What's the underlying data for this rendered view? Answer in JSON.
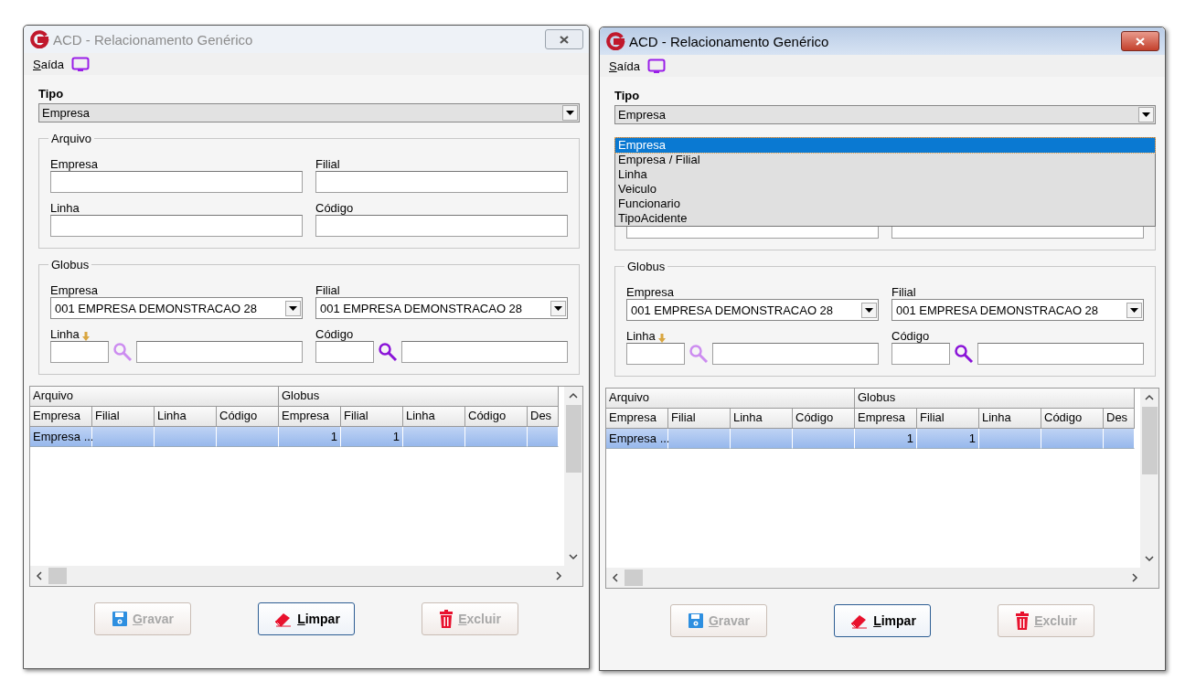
{
  "windows": [
    {
      "active": false,
      "title": "ACD - Relacionamento Genérico",
      "menu": [
        {
          "label": "Saída"
        }
      ],
      "tipo": {
        "label": "Tipo",
        "value": "Empresa"
      },
      "arquivo": {
        "legend": "Arquivo",
        "fields": [
          {
            "label": "Empresa"
          },
          {
            "label": "Filial"
          },
          {
            "label": "Linha"
          },
          {
            "label": "Código"
          }
        ]
      },
      "globus": {
        "legend": "Globus",
        "fields": [
          {
            "label": "Empresa",
            "kind": "combo",
            "value": "001 EMPRESA DEMONSTRACAO 28"
          },
          {
            "label": "Filial",
            "kind": "combo",
            "value": "001 EMPRESA DEMONSTRACAO 28"
          },
          {
            "label": "Linha",
            "kind": "lookup",
            "marked": true,
            "search_active": false
          },
          {
            "label": "Código",
            "kind": "lookup",
            "marked": false,
            "search_active": true
          }
        ]
      },
      "grid": {
        "groups": [
          {
            "label": "Arquivo",
            "columns": [
              {
                "label": "Empresa",
                "kind": "text"
              },
              {
                "label": "Filial",
                "kind": "text"
              },
              {
                "label": "Linha",
                "kind": "text"
              },
              {
                "label": "Código",
                "kind": "text"
              }
            ]
          },
          {
            "label": "Globus",
            "columns": [
              {
                "label": "Empresa",
                "kind": "number"
              },
              {
                "label": "Filial",
                "kind": "number"
              },
              {
                "label": "Linha",
                "kind": "text"
              },
              {
                "label": "Código",
                "kind": "text"
              },
              {
                "label": "Des",
                "kind": "text"
              }
            ]
          }
        ],
        "rows": [
          {
            "selected": true,
            "cells": [
              "Empresa ...",
              null,
              null,
              null,
              "1",
              "1",
              null,
              null,
              null
            ]
          }
        ]
      },
      "buttons": [
        {
          "label": "Gravar",
          "kind": "save",
          "disabled": true,
          "default": false
        },
        {
          "label": "Limpar",
          "kind": "clear",
          "disabled": false,
          "default": true
        },
        {
          "label": "Excluir",
          "kind": "delete",
          "disabled": true,
          "default": false
        }
      ]
    },
    {
      "active": true,
      "title": "ACD - Relacionamento Genérico",
      "menu": [
        {
          "label": "Saída"
        }
      ],
      "tipo": {
        "label": "Tipo",
        "value": "Empresa",
        "options": [
          {
            "label": "Empresa",
            "selected": true
          },
          {
            "label": "Empresa / Filial",
            "selected": false
          },
          {
            "label": "Linha",
            "selected": false
          },
          {
            "label": "Veiculo",
            "selected": false
          },
          {
            "label": "Funcionario",
            "selected": false
          },
          {
            "label": "TipoAcidente",
            "selected": false
          }
        ]
      },
      "arquivo": {
        "fields": [
          {
            "kind": "input"
          },
          {
            "kind": "input"
          }
        ]
      },
      "globus": {
        "legend": "Globus",
        "fields": [
          {
            "label": "Empresa",
            "kind": "combo",
            "value": "001 EMPRESA DEMONSTRACAO 28"
          },
          {
            "label": "Filial",
            "kind": "combo",
            "value": "001 EMPRESA DEMONSTRACAO 28"
          },
          {
            "label": "Linha",
            "kind": "lookup",
            "marked": true,
            "search_active": false
          },
          {
            "label": "Código",
            "kind": "lookup",
            "marked": false,
            "search_active": true
          }
        ]
      },
      "grid": {
        "groups": [
          {
            "label": "Arquivo",
            "columns": [
              {
                "label": "Empresa",
                "kind": "text"
              },
              {
                "label": "Filial",
                "kind": "text"
              },
              {
                "label": "Linha",
                "kind": "text"
              },
              {
                "label": "Código",
                "kind": "text"
              }
            ]
          },
          {
            "label": "Globus",
            "columns": [
              {
                "label": "Empresa",
                "kind": "number"
              },
              {
                "label": "Filial",
                "kind": "number"
              },
              {
                "label": "Linha",
                "kind": "text"
              },
              {
                "label": "Código",
                "kind": "text"
              },
              {
                "label": "Des",
                "kind": "text"
              }
            ]
          }
        ],
        "rows": [
          {
            "selected": true,
            "cells": [
              "Empresa ...",
              null,
              null,
              null,
              "1",
              "1",
              null,
              null,
              null
            ]
          }
        ]
      },
      "buttons": [
        {
          "label": "Gravar",
          "kind": "save",
          "disabled": true,
          "default": false
        },
        {
          "label": "Limpar",
          "kind": "clear",
          "disabled": false,
          "default": true
        },
        {
          "label": "Excluir",
          "kind": "delete",
          "disabled": true,
          "default": false
        }
      ]
    }
  ]
}
